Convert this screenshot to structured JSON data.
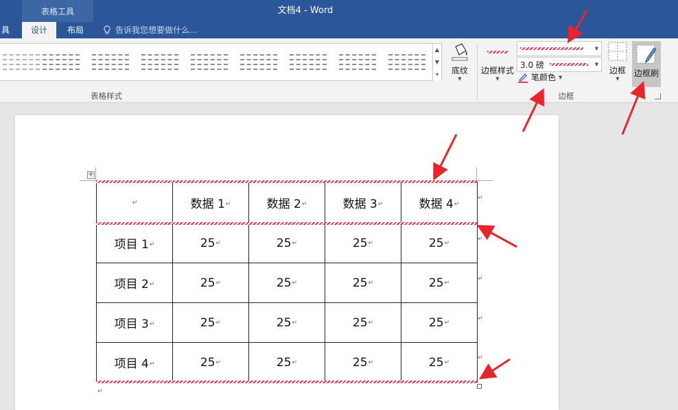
{
  "titlebar": {
    "context_group": "表格工具",
    "document_title": "文档4 - Word",
    "tabs": [
      {
        "label": "具",
        "active": false
      },
      {
        "label": "设计",
        "active": true
      },
      {
        "label": "布局",
        "active": false
      }
    ],
    "tell_me_placeholder": "告诉我您想要做什么..."
  },
  "ribbon": {
    "table_styles_label": "表格样式",
    "shading_label": "底纹",
    "border_styles_label": "边框样式",
    "line_weight": "3.0 磅",
    "pen_color_label": "笔颜色",
    "borders_label": "边框",
    "border_painter_label": "边框刷",
    "borders_group_label": "边框"
  },
  "table": {
    "header": [
      "",
      "数据 1",
      "数据 2",
      "数据 3",
      "数据 4"
    ],
    "rows": [
      [
        "项目 1",
        "25",
        "25",
        "25",
        "25"
      ],
      [
        "项目 2",
        "25",
        "25",
        "25",
        "25"
      ],
      [
        "项目 3",
        "25",
        "25",
        "25",
        "25"
      ],
      [
        "项目 4",
        "25",
        "25",
        "25",
        "25"
      ]
    ]
  },
  "colors": {
    "title_blue": "#2b579a",
    "accent_red": "#e8354a"
  }
}
